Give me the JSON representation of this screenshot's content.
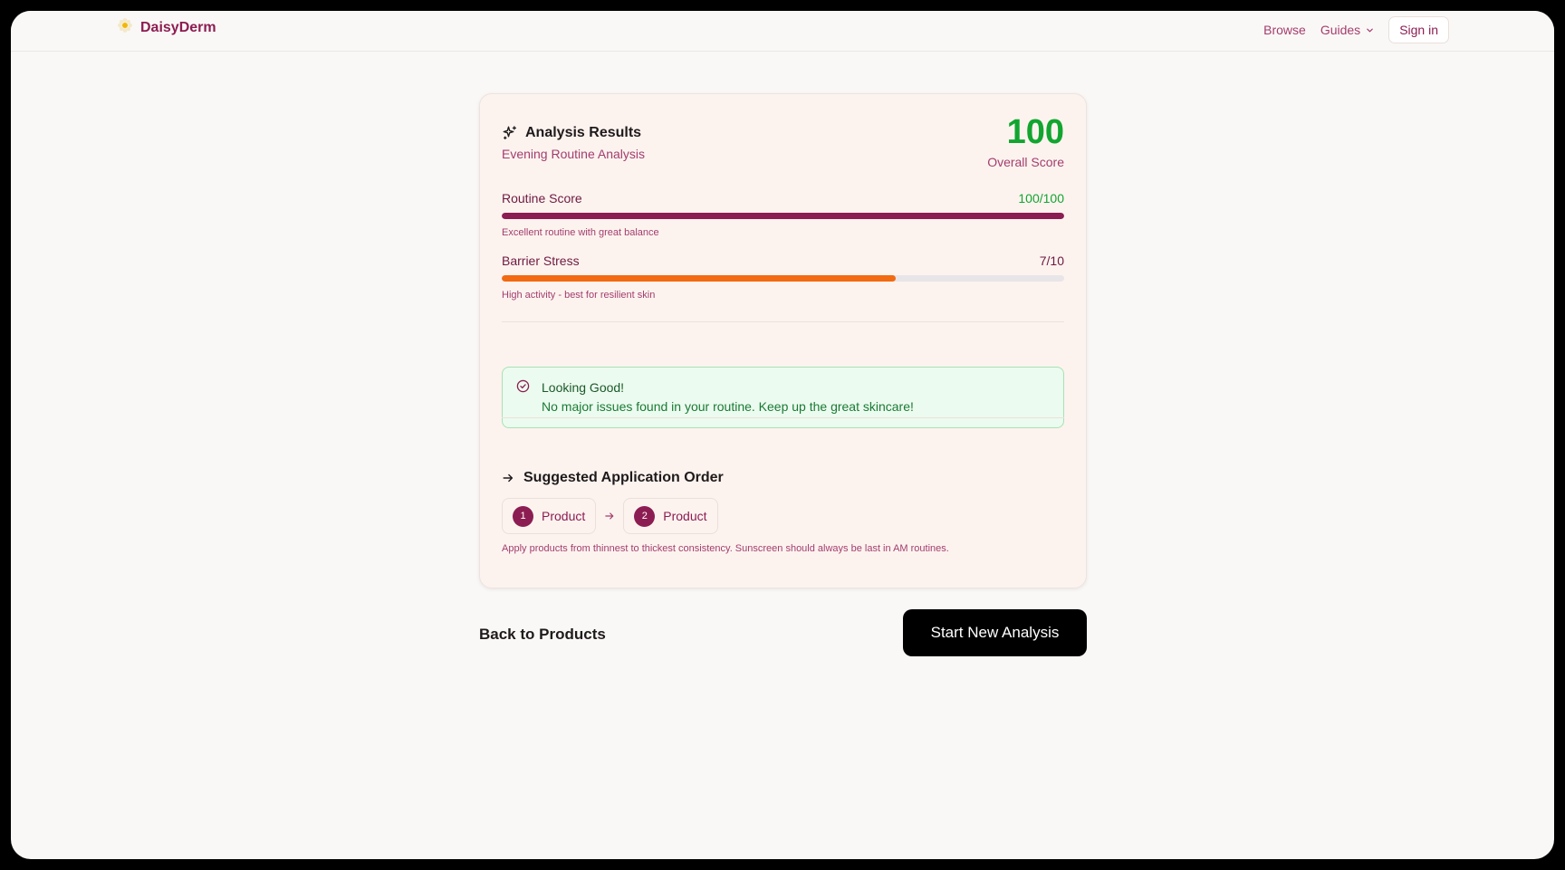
{
  "app": {
    "name": "DaisyDerm",
    "logo_icon": "daisy-icon"
  },
  "nav": {
    "browse": "Browse",
    "guides": "Guides",
    "signin": "Sign in"
  },
  "results": {
    "title": "Analysis Results",
    "subtitle": "Evening Routine Analysis",
    "overall_score": "100",
    "overall_label": "Overall Score",
    "routine": {
      "label": "Routine Score",
      "value_text": "100/100",
      "fraction": 1.0,
      "note": "Excellent routine with great balance",
      "color": "#8c1d52",
      "value_color": "#12a52f"
    },
    "barrier": {
      "label": "Barrier Stress",
      "value_text": "7/10",
      "fraction": 0.7,
      "note": "High activity - best for resilient skin",
      "color": "#f26a12",
      "value_color": "#6e1a40"
    },
    "alert": {
      "title": "Looking Good!",
      "text": "No major issues found in your routine. Keep up the great skincare!"
    },
    "order": {
      "title": "Suggested Application Order",
      "steps": [
        {
          "num": "1",
          "label": "Product"
        },
        {
          "num": "2",
          "label": "Product"
        }
      ],
      "tip": "Apply products from thinnest to thickest consistency. Sunscreen should always be last in AM routines."
    }
  },
  "actions": {
    "back": "Back to Products",
    "new": "Start New Analysis"
  }
}
